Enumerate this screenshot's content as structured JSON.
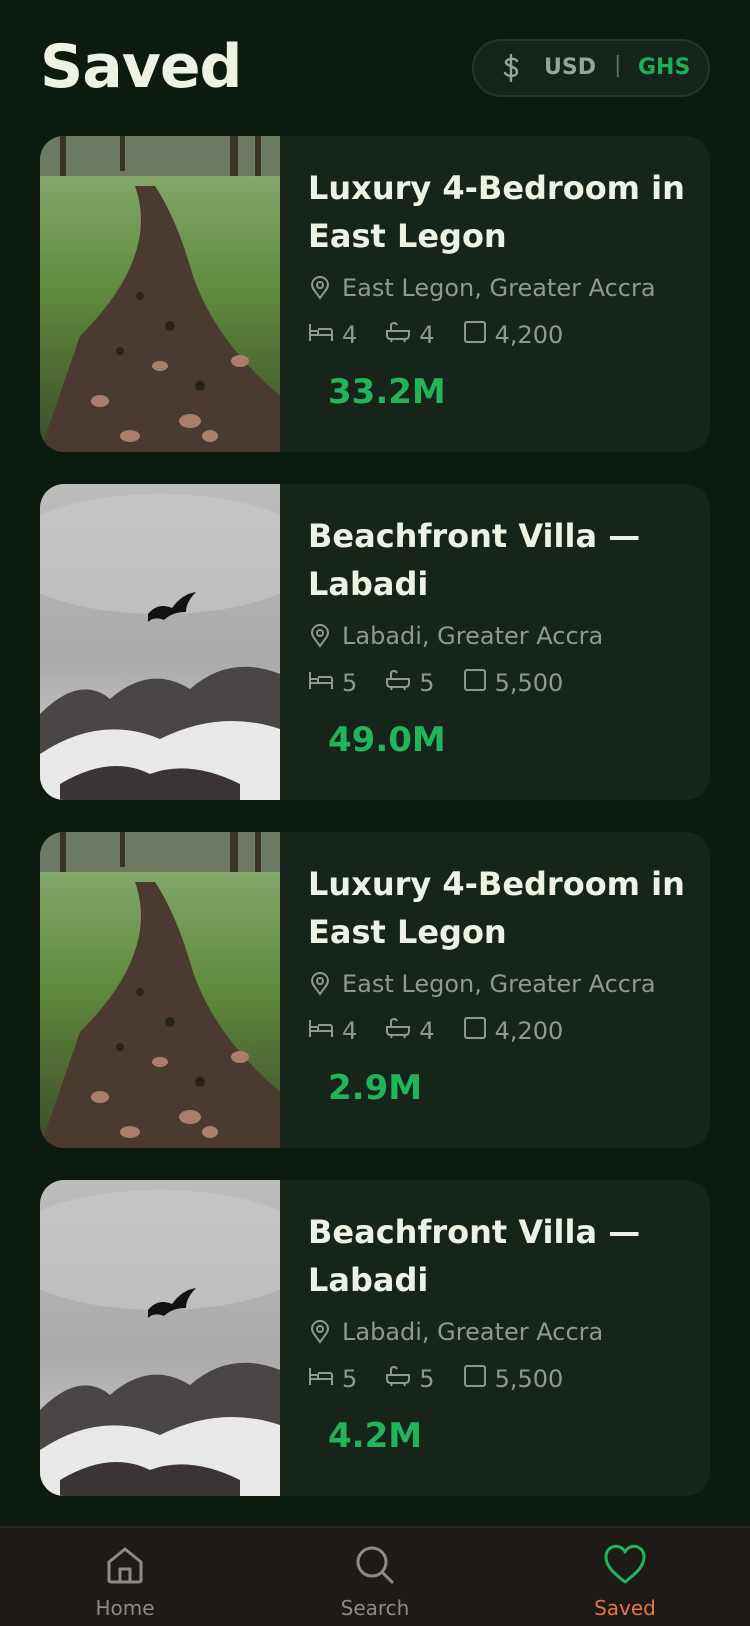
{
  "header": {
    "title": "Saved",
    "currency": {
      "symbol_icon": "dollar-icon",
      "usd_label": "USD",
      "separator": "|",
      "ghs_label": "GHS",
      "active": "GHS",
      "active_color": "#1fae56"
    }
  },
  "listings": [
    {
      "image": "forest-path",
      "title": "Luxury 4-Bedroom in East Legon",
      "location": "East Legon, Greater Accra",
      "beds": "4",
      "baths": "4",
      "area": "4,200",
      "price": "33.2M"
    },
    {
      "image": "misty-mountain-bird",
      "title": "Beachfront Villa — Labadi",
      "location": "Labadi, Greater Accra",
      "beds": "5",
      "baths": "5",
      "area": "5,500",
      "price": "49.0M"
    },
    {
      "image": "forest-path",
      "title": "Luxury 4-Bedroom in East Legon",
      "location": "East Legon, Greater Accra",
      "beds": "4",
      "baths": "4",
      "area": "4,200",
      "price": "2.9M"
    },
    {
      "image": "misty-mountain-bird",
      "title": "Beachfront Villa — Labadi",
      "location": "Labadi, Greater Accra",
      "beds": "5",
      "baths": "5",
      "area": "5,500",
      "price": "4.2M"
    }
  ],
  "nav": {
    "items": [
      {
        "label": "Home",
        "icon": "home-icon"
      },
      {
        "label": "Search",
        "icon": "search-icon"
      },
      {
        "label": "Saved",
        "icon": "heart-icon"
      }
    ],
    "active": "Saved",
    "active_color": "#e8734a",
    "active_icon_color": "#22b45a"
  }
}
